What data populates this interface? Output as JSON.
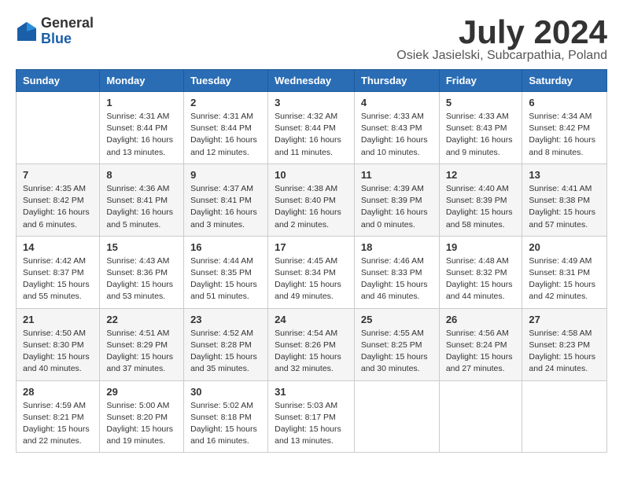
{
  "logo": {
    "general": "General",
    "blue": "Blue"
  },
  "title": "July 2024",
  "subtitle": "Osiek Jasielski, Subcarpathia, Poland",
  "headers": [
    "Sunday",
    "Monday",
    "Tuesday",
    "Wednesday",
    "Thursday",
    "Friday",
    "Saturday"
  ],
  "weeks": [
    [
      {
        "day": "",
        "info": ""
      },
      {
        "day": "1",
        "info": "Sunrise: 4:31 AM\nSunset: 8:44 PM\nDaylight: 16 hours\nand 13 minutes."
      },
      {
        "day": "2",
        "info": "Sunrise: 4:31 AM\nSunset: 8:44 PM\nDaylight: 16 hours\nand 12 minutes."
      },
      {
        "day": "3",
        "info": "Sunrise: 4:32 AM\nSunset: 8:44 PM\nDaylight: 16 hours\nand 11 minutes."
      },
      {
        "day": "4",
        "info": "Sunrise: 4:33 AM\nSunset: 8:43 PM\nDaylight: 16 hours\nand 10 minutes."
      },
      {
        "day": "5",
        "info": "Sunrise: 4:33 AM\nSunset: 8:43 PM\nDaylight: 16 hours\nand 9 minutes."
      },
      {
        "day": "6",
        "info": "Sunrise: 4:34 AM\nSunset: 8:42 PM\nDaylight: 16 hours\nand 8 minutes."
      }
    ],
    [
      {
        "day": "7",
        "info": "Sunrise: 4:35 AM\nSunset: 8:42 PM\nDaylight: 16 hours\nand 6 minutes."
      },
      {
        "day": "8",
        "info": "Sunrise: 4:36 AM\nSunset: 8:41 PM\nDaylight: 16 hours\nand 5 minutes."
      },
      {
        "day": "9",
        "info": "Sunrise: 4:37 AM\nSunset: 8:41 PM\nDaylight: 16 hours\nand 3 minutes."
      },
      {
        "day": "10",
        "info": "Sunrise: 4:38 AM\nSunset: 8:40 PM\nDaylight: 16 hours\nand 2 minutes."
      },
      {
        "day": "11",
        "info": "Sunrise: 4:39 AM\nSunset: 8:39 PM\nDaylight: 16 hours\nand 0 minutes."
      },
      {
        "day": "12",
        "info": "Sunrise: 4:40 AM\nSunset: 8:39 PM\nDaylight: 15 hours\nand 58 minutes."
      },
      {
        "day": "13",
        "info": "Sunrise: 4:41 AM\nSunset: 8:38 PM\nDaylight: 15 hours\nand 57 minutes."
      }
    ],
    [
      {
        "day": "14",
        "info": "Sunrise: 4:42 AM\nSunset: 8:37 PM\nDaylight: 15 hours\nand 55 minutes."
      },
      {
        "day": "15",
        "info": "Sunrise: 4:43 AM\nSunset: 8:36 PM\nDaylight: 15 hours\nand 53 minutes."
      },
      {
        "day": "16",
        "info": "Sunrise: 4:44 AM\nSunset: 8:35 PM\nDaylight: 15 hours\nand 51 minutes."
      },
      {
        "day": "17",
        "info": "Sunrise: 4:45 AM\nSunset: 8:34 PM\nDaylight: 15 hours\nand 49 minutes."
      },
      {
        "day": "18",
        "info": "Sunrise: 4:46 AM\nSunset: 8:33 PM\nDaylight: 15 hours\nand 46 minutes."
      },
      {
        "day": "19",
        "info": "Sunrise: 4:48 AM\nSunset: 8:32 PM\nDaylight: 15 hours\nand 44 minutes."
      },
      {
        "day": "20",
        "info": "Sunrise: 4:49 AM\nSunset: 8:31 PM\nDaylight: 15 hours\nand 42 minutes."
      }
    ],
    [
      {
        "day": "21",
        "info": "Sunrise: 4:50 AM\nSunset: 8:30 PM\nDaylight: 15 hours\nand 40 minutes."
      },
      {
        "day": "22",
        "info": "Sunrise: 4:51 AM\nSunset: 8:29 PM\nDaylight: 15 hours\nand 37 minutes."
      },
      {
        "day": "23",
        "info": "Sunrise: 4:52 AM\nSunset: 8:28 PM\nDaylight: 15 hours\nand 35 minutes."
      },
      {
        "day": "24",
        "info": "Sunrise: 4:54 AM\nSunset: 8:26 PM\nDaylight: 15 hours\nand 32 minutes."
      },
      {
        "day": "25",
        "info": "Sunrise: 4:55 AM\nSunset: 8:25 PM\nDaylight: 15 hours\nand 30 minutes."
      },
      {
        "day": "26",
        "info": "Sunrise: 4:56 AM\nSunset: 8:24 PM\nDaylight: 15 hours\nand 27 minutes."
      },
      {
        "day": "27",
        "info": "Sunrise: 4:58 AM\nSunset: 8:23 PM\nDaylight: 15 hours\nand 24 minutes."
      }
    ],
    [
      {
        "day": "28",
        "info": "Sunrise: 4:59 AM\nSunset: 8:21 PM\nDaylight: 15 hours\nand 22 minutes."
      },
      {
        "day": "29",
        "info": "Sunrise: 5:00 AM\nSunset: 8:20 PM\nDaylight: 15 hours\nand 19 minutes."
      },
      {
        "day": "30",
        "info": "Sunrise: 5:02 AM\nSunset: 8:18 PM\nDaylight: 15 hours\nand 16 minutes."
      },
      {
        "day": "31",
        "info": "Sunrise: 5:03 AM\nSunset: 8:17 PM\nDaylight: 15 hours\nand 13 minutes."
      },
      {
        "day": "",
        "info": ""
      },
      {
        "day": "",
        "info": ""
      },
      {
        "day": "",
        "info": ""
      }
    ]
  ]
}
